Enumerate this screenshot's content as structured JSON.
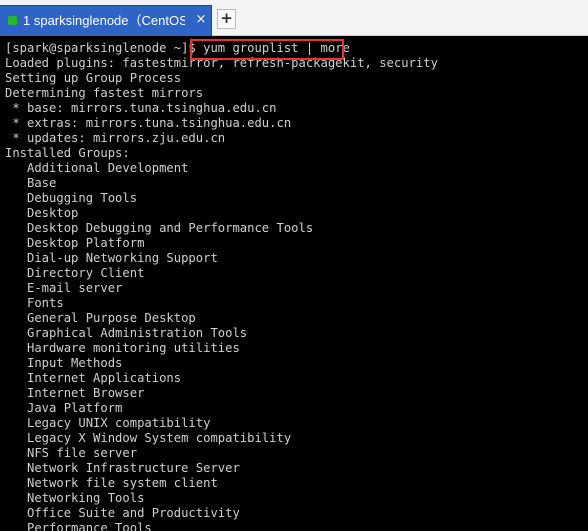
{
  "tab": {
    "title": "1 sparksinglenode（CentOS",
    "close_icon": "×",
    "status_color": "#25b828"
  },
  "new_tab_icon": "+",
  "terminal": {
    "prompt": "[spark@sparksinglenode ~]$ ",
    "command": "yum grouplist | more",
    "output": [
      "Loaded plugins: fastestmirror, refresh-packagekit, security",
      "Setting up Group Process",
      "Determining fastest mirrors",
      " * base: mirrors.tuna.tsinghua.edu.cn",
      " * extras: mirrors.tuna.tsinghua.edu.cn",
      " * updates: mirrors.zju.edu.cn",
      "Installed Groups:",
      "   Additional Development",
      "   Base",
      "   Debugging Tools",
      "   Desktop",
      "   Desktop Debugging and Performance Tools",
      "   Desktop Platform",
      "   Dial-up Networking Support",
      "   Directory Client",
      "   E-mail server",
      "   Fonts",
      "   General Purpose Desktop",
      "   Graphical Administration Tools",
      "   Hardware monitoring utilities",
      "   Input Methods",
      "   Internet Applications",
      "   Internet Browser",
      "   Java Platform",
      "   Legacy UNIX compatibility",
      "   Legacy X Window System compatibility",
      "   NFS file server",
      "   Network Infrastructure Server",
      "   Network file system client",
      "   Networking Tools",
      "   Office Suite and Productivity",
      "   Performance Tools"
    ]
  },
  "colors": {
    "tab_active": "#2f64c7",
    "terminal_bg": "#000000",
    "terminal_fg": "#d0d0d0",
    "highlight": "#e8342c"
  }
}
